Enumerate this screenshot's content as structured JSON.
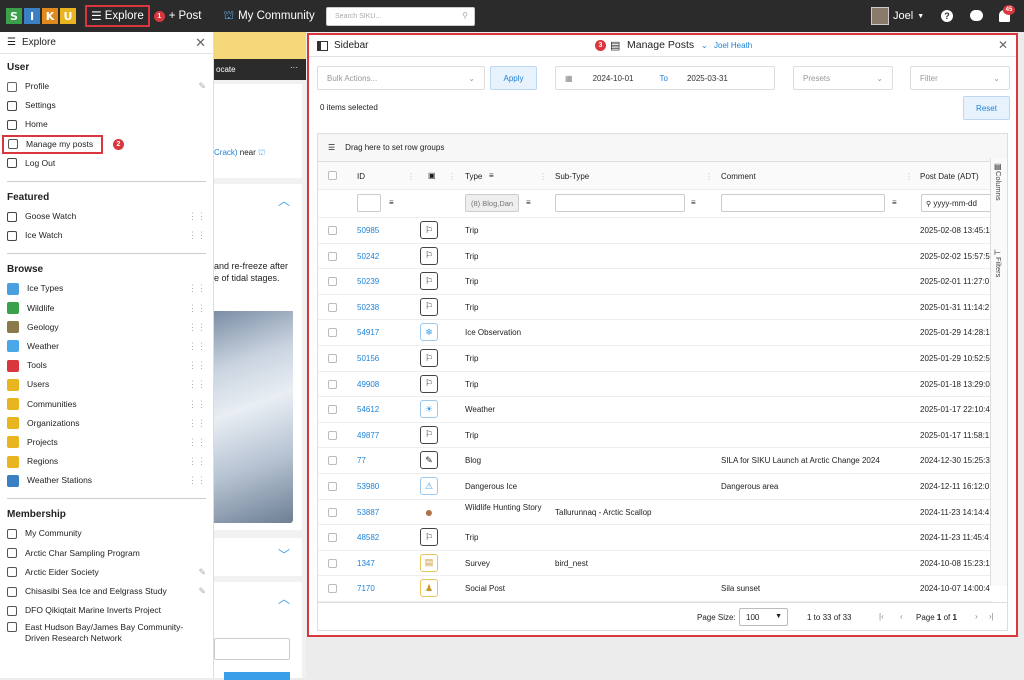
{
  "topbar": {
    "logo": [
      "S",
      "I",
      "K",
      "U"
    ],
    "logo_colors": [
      "#3aa04a",
      "#3b7fc4",
      "#e08a1e",
      "#e8b41f"
    ],
    "explore": "Explore",
    "step1": "1",
    "post": "Post",
    "community": "My Community",
    "search_placeholder": "Search SIKU...",
    "user": "Joel",
    "notif_count": "45"
  },
  "explore": {
    "title": "Explore",
    "sections": [
      {
        "name": "User",
        "items": [
          {
            "label": "Profile",
            "icon": "profile-icon",
            "color": "#666"
          },
          {
            "label": "Settings",
            "icon": "gear-icon",
            "color": "#444"
          },
          {
            "label": "Home",
            "icon": "home-icon",
            "color": "#444"
          },
          {
            "label": "Manage my posts",
            "icon": "list-icon",
            "color": "#555",
            "step": "2"
          },
          {
            "label": "Log Out",
            "icon": "logout-icon",
            "color": "#444"
          }
        ]
      },
      {
        "name": "Featured",
        "items": [
          {
            "label": "Goose Watch",
            "icon": "goose-icon",
            "color": "#444"
          },
          {
            "label": "Ice Watch",
            "icon": "ice-watch-icon",
            "color": "#444"
          }
        ]
      },
      {
        "name": "Browse",
        "items": [
          {
            "label": "Ice Types",
            "icon": "ice-types-icon",
            "color": "#4a9fe0"
          },
          {
            "label": "Wildlife",
            "icon": "wildlife-icon",
            "color": "#3aa04a"
          },
          {
            "label": "Geology",
            "icon": "geology-icon",
            "color": "#8a7a4a"
          },
          {
            "label": "Weather",
            "icon": "weather-icon",
            "color": "#4aa8e8"
          },
          {
            "label": "Tools",
            "icon": "tools-icon",
            "color": "#d9363e"
          },
          {
            "label": "Users",
            "icon": "users-icon",
            "color": "#e8b41f"
          },
          {
            "label": "Communities",
            "icon": "communities-icon",
            "color": "#e8b41f"
          },
          {
            "label": "Organizations",
            "icon": "organizations-icon",
            "color": "#e8b41f"
          },
          {
            "label": "Projects",
            "icon": "projects-icon",
            "color": "#e8b41f"
          },
          {
            "label": "Regions",
            "icon": "regions-icon",
            "color": "#e8b41f"
          },
          {
            "label": "Weather Stations",
            "icon": "weather-station-icon",
            "color": "#3b7fc4"
          }
        ]
      },
      {
        "name": "Membership",
        "items": [
          {
            "label": "My Community",
            "icon": "community-icon",
            "color": "#555"
          },
          {
            "label": "Arctic Char Sampling Program",
            "icon": "org-icon",
            "color": "#555"
          },
          {
            "label": "Arctic Eider Society",
            "icon": "org-icon",
            "color": "#555"
          },
          {
            "label": "Chisasibi Sea Ice and Eelgrass Study",
            "icon": "org-icon",
            "color": "#555"
          },
          {
            "label": "DFO Qikiqtait Marine Inverts Project",
            "icon": "org-icon",
            "color": "#555"
          },
          {
            "label": "East Hudson Bay/James Bay Community-Driven Research Network",
            "icon": "org-icon",
            "color": "#555"
          }
        ]
      }
    ]
  },
  "background_card": {
    "tab": "ocate",
    "snippet_link": "Crack)",
    "snippet_near": " near",
    "text_line1": "and re-freeze after",
    "text_line2": "e of tidal stages."
  },
  "panel": {
    "sidebar_label": "Sidebar",
    "step3": "3",
    "title": "Manage Posts",
    "user_link": "Joel Heath",
    "bulk_actions": "Bulk Actions...",
    "apply": "Apply",
    "date_from": "2024-10-01",
    "to": "To",
    "date_to": "2025-03-31",
    "presets": "Presets",
    "filter": "Filter",
    "items_selected": "0 items selected",
    "reset": "Reset",
    "group_hint": "Drag here to set row groups",
    "columns_tab": "Columns",
    "filters_tab": "Filters"
  },
  "table": {
    "headers": {
      "id": "ID",
      "type": "Type",
      "subtype": "Sub-Type",
      "comment": "Comment",
      "date": "Post Date (ADT)"
    },
    "type_filter": "(8) Blog,Dan",
    "date_placeholder": "yyyy-mm-dd",
    "rows": [
      {
        "id": "50985",
        "type": "Trip",
        "subtype": "",
        "comment": "",
        "date": "2025-02-08 13:45:1",
        "icon": "trip-icon"
      },
      {
        "id": "50242",
        "type": "Trip",
        "subtype": "",
        "comment": "",
        "date": "2025-02-02 15:57:5",
        "icon": "trip-icon"
      },
      {
        "id": "50239",
        "type": "Trip",
        "subtype": "",
        "comment": "",
        "date": "2025-02-01 11:27:0",
        "icon": "trip-icon"
      },
      {
        "id": "50238",
        "type": "Trip",
        "subtype": "",
        "comment": "",
        "date": "2025-01-31 11:14:2",
        "icon": "trip-icon"
      },
      {
        "id": "54917",
        "type": "Ice Observation",
        "subtype": "",
        "comment": "",
        "date": "2025-01-29 14:28:1",
        "icon": "ice-observation-icon"
      },
      {
        "id": "50156",
        "type": "Trip",
        "subtype": "",
        "comment": "",
        "date": "2025-01-29 10:52:5",
        "icon": "trip-icon"
      },
      {
        "id": "49908",
        "type": "Trip",
        "subtype": "",
        "comment": "",
        "date": "2025-01-18 13:29:0",
        "icon": "trip-icon"
      },
      {
        "id": "54612",
        "type": "Weather",
        "subtype": "",
        "comment": "",
        "date": "2025-01-17 22:10:4",
        "icon": "weather-icon"
      },
      {
        "id": "49877",
        "type": "Trip",
        "subtype": "",
        "comment": "",
        "date": "2025-01-17 11:58:1",
        "icon": "trip-icon"
      },
      {
        "id": "77",
        "type": "Blog",
        "subtype": "",
        "comment": "SILA for SIKU Launch at Arctic Change 2024",
        "date": "2024-12-30 15:25:3",
        "icon": "blog-icon"
      },
      {
        "id": "53980",
        "type": "Dangerous Ice",
        "subtype": "",
        "comment": "Dangerous area",
        "date": "2024-12-11 16:12:0",
        "icon": "dangerous-ice-icon"
      },
      {
        "id": "53887",
        "type": "Wildlife Hunting Story",
        "subtype": "Tallurunnaq - Arctic Scallop",
        "comment": "",
        "date": "2024-11-23 14:14:4",
        "icon": "scallop-icon"
      },
      {
        "id": "48582",
        "type": "Trip",
        "subtype": "",
        "comment": "",
        "date": "2024-11-23 11:45:4",
        "icon": "trip-icon"
      },
      {
        "id": "1347",
        "type": "Survey",
        "subtype": "bird_nest",
        "comment": "",
        "date": "2024-10-08 15:23:1",
        "icon": "survey-icon"
      },
      {
        "id": "7170",
        "type": "Social Post",
        "subtype": "",
        "comment": "Sila sunset",
        "date": "2024-10-07 14:00:4",
        "icon": "social-post-icon"
      }
    ]
  },
  "pager": {
    "page_size_label": "Page Size:",
    "page_size": "100",
    "range": "1 to 33 of 33",
    "page_word": "Page",
    "page_cur": "1",
    "page_of": "of",
    "page_total": "1"
  }
}
